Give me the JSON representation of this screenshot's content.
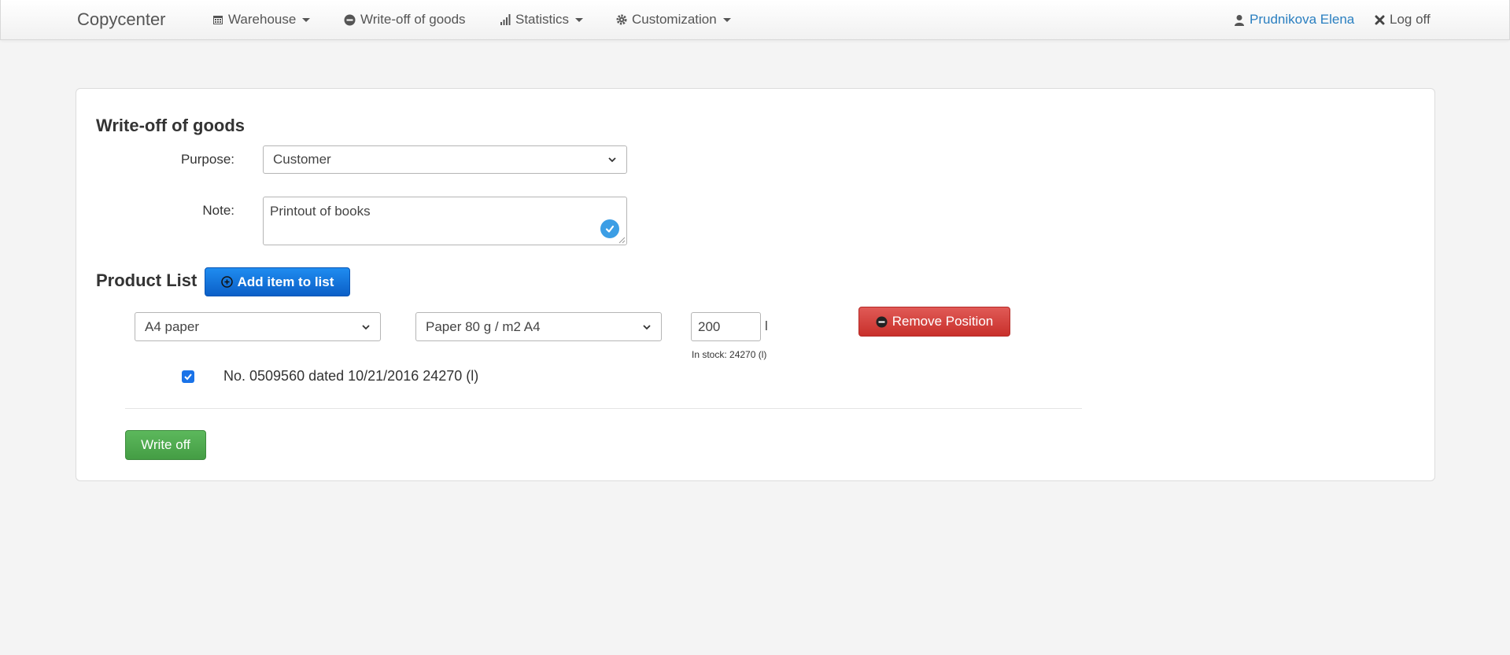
{
  "navbar": {
    "brand": "Copycenter",
    "items": [
      {
        "label": "Warehouse",
        "icon": "calendar-icon",
        "dropdown": true
      },
      {
        "label": "Write-off of goods",
        "icon": "minus-circle-icon",
        "dropdown": false
      },
      {
        "label": "Statistics",
        "icon": "signal-icon",
        "dropdown": true
      },
      {
        "label": "Customization",
        "icon": "gear-icon",
        "dropdown": true
      }
    ],
    "user": {
      "name": "Prudnikova Elena",
      "icon": "user-icon"
    },
    "logout": {
      "label": "Log off",
      "icon": "close-icon"
    }
  },
  "form": {
    "title": "Write-off of goods",
    "purpose_label": "Purpose:",
    "purpose_value": "Customer",
    "note_label": "Note:",
    "note_value": "Printout of books"
  },
  "product_list": {
    "title": "Product List",
    "add_button": "Add item to list",
    "rows": [
      {
        "category": "A4 paper",
        "product": "Paper 80 g / m2 A4",
        "quantity": "200",
        "unit": "l",
        "stock_text": "In stock: 24270 (l)",
        "remove_button": "Remove Position",
        "batch": {
          "checked": true,
          "text": "No. 0509560 dated 10/21/2016 24270 (l)"
        }
      }
    ]
  },
  "actions": {
    "write_off": "Write off"
  },
  "colors": {
    "primary": "#0b6fd6",
    "danger": "#d9534f",
    "success": "#5cb85c",
    "link": "#2a7fc0"
  }
}
